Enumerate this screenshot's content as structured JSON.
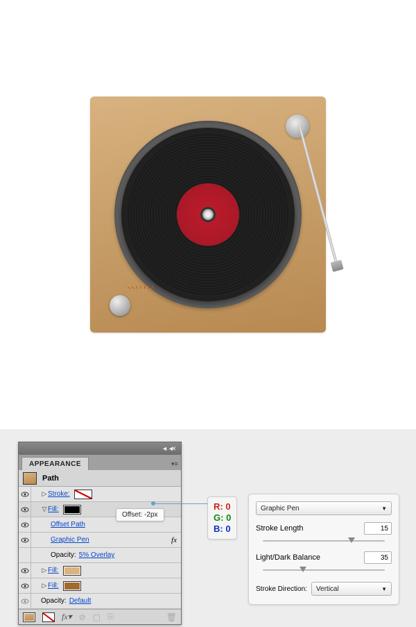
{
  "panel": {
    "title": "APPEARANCE",
    "selected_item": "Path",
    "rows": {
      "stroke_label": "Stroke:",
      "fill_label": "Fill:",
      "offset_path": "Offset Path",
      "graphic_pen": "Graphic Pen",
      "opacity_label": "Opacity:",
      "opacity_overlay": "5% Overlay",
      "opacity_default": "Default"
    }
  },
  "tooltip": {
    "offset": "Offset: -2px"
  },
  "rgb": {
    "r_label": "R:",
    "r_value": "0",
    "g_label": "G:",
    "g_value": "0",
    "b_label": "B:",
    "b_value": "0"
  },
  "fx": {
    "effect_name": "Graphic Pen",
    "stroke_length_label": "Stroke Length",
    "stroke_length_value": "15",
    "balance_label": "Light/Dark Balance",
    "balance_value": "35",
    "direction_label": "Stroke Direction:",
    "direction_value": "Vertical"
  }
}
